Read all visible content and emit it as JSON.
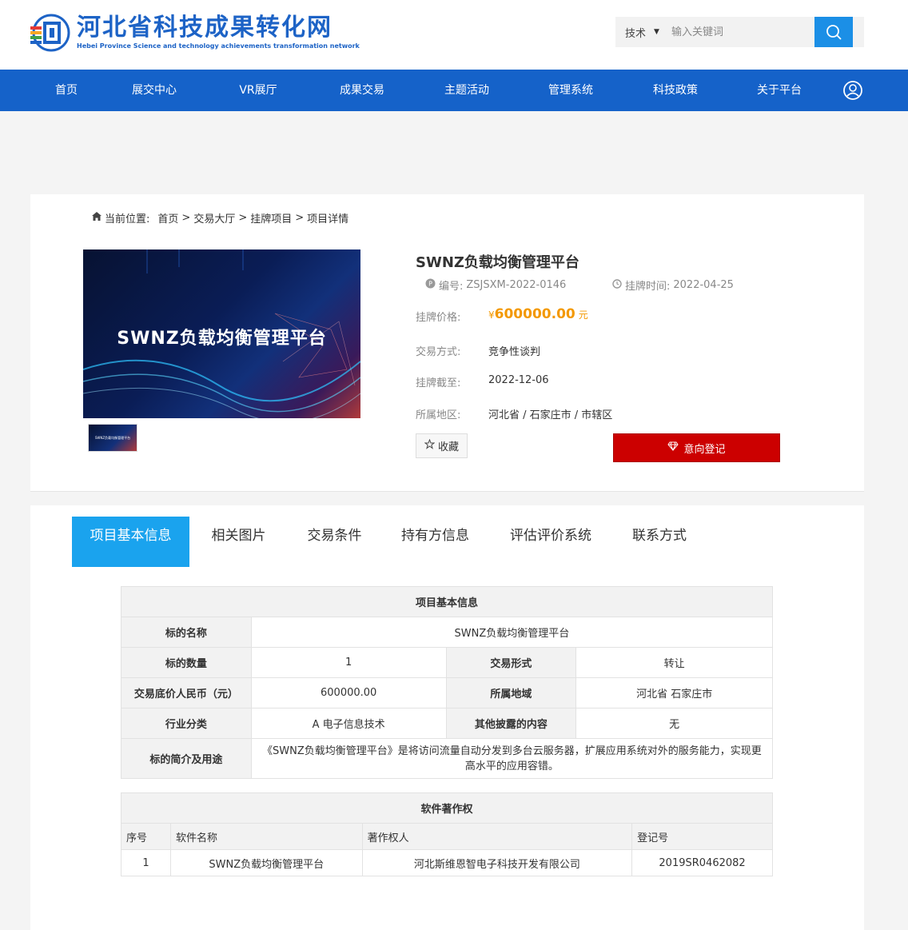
{
  "header": {
    "logo_title": "河北省科技成果转化网",
    "logo_subtitle": "Hebei Province Science and technology achievements transformation network",
    "search": {
      "type_label": "技术",
      "placeholder": "输入关键词"
    }
  },
  "nav": {
    "items": [
      "首页",
      "展交中心",
      "VR展厅",
      "成果交易",
      "主题活动",
      "管理系统",
      "科技政策",
      "关于平台"
    ]
  },
  "breadcrumb": {
    "prefix": "当前位置:",
    "items": [
      "首页",
      "交易大厅",
      "挂牌项目",
      "项目详情"
    ],
    "separator": ">"
  },
  "product": {
    "image_title": "SWNZ负载均衡管理平台",
    "title": "SWNZ负载均衡管理平台",
    "code_label": "编号:",
    "code": "ZSJSXM-2022-0146",
    "date_label": "挂牌时间:",
    "date": "2022-04-25",
    "price_label": "挂牌价格:",
    "price_symbol": "¥",
    "price": "600000.00",
    "price_unit": "元",
    "trade_method_label": "交易方式:",
    "trade_method": "竞争性谈判",
    "deadline_label": "挂牌截至:",
    "deadline": "2022-12-06",
    "region_label": "所属地区:",
    "region": "河北省 / 石家庄市 / 市辖区",
    "favorite_label": "收藏",
    "register_label": "意向登记"
  },
  "tabs": [
    "项目基本信息",
    "相关图片",
    "交易条件",
    "持有方信息",
    "评估评价系统",
    "联系方式"
  ],
  "basic_info": {
    "caption": "项目基本信息",
    "name_label": "标的名称",
    "name": "SWNZ负载均衡管理平台",
    "quantity_label": "标的数量",
    "quantity": "1",
    "trade_form_label": "交易形式",
    "trade_form": "转让",
    "price_label": "交易底价人民币（元）",
    "price": "600000.00",
    "region_label": "所属地域",
    "region": "河北省 石家庄市",
    "industry_label": "行业分类",
    "industry": "A 电子信息技术",
    "other_label": "其他披露的内容",
    "other": "无",
    "intro_label": "标的简介及用途",
    "intro": "《SWNZ负载均衡管理平台》是将访问流量自动分发到多台云服务器，扩展应用系统对外的服务能力，实现更高水平的应用容错。"
  },
  "copyright": {
    "caption": "软件著作权",
    "headers": [
      "序号",
      "软件名称",
      "著作权人",
      "登记号"
    ],
    "rows": [
      [
        "1",
        "SWNZ负载均衡管理平台",
        "河北斯维恩智电子科技开发有限公司",
        "2019SR0462082"
      ]
    ]
  },
  "colors": {
    "nav_bg": "#1562c9",
    "active_tab": "#1aa3ee",
    "register_btn": "#cc0000",
    "price": "#f39800"
  }
}
